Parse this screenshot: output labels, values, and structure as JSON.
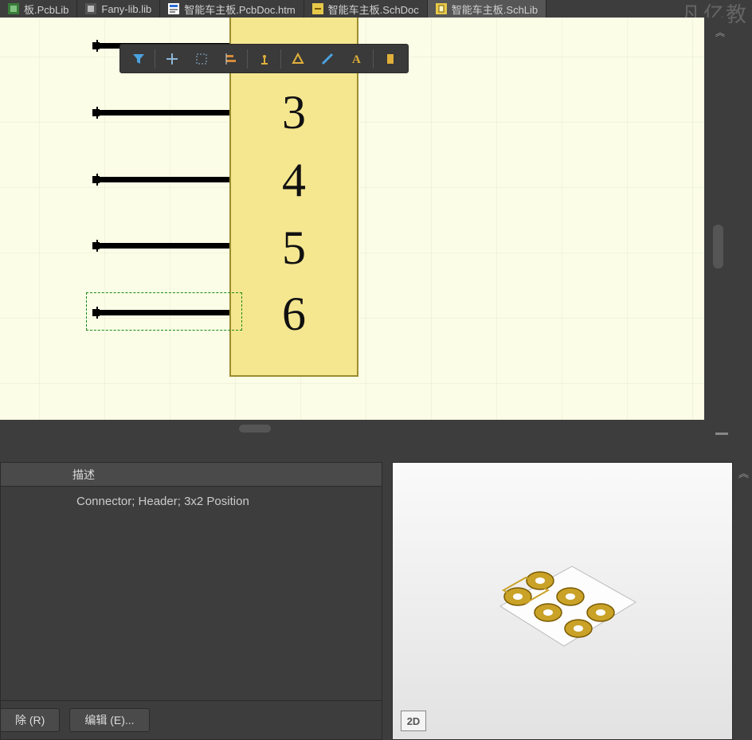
{
  "tabs": [
    {
      "label": "板.PcbLib",
      "icon": "pcblib"
    },
    {
      "label": "Fany-lib.lib",
      "icon": "lib"
    },
    {
      "label": "智能车主板.PcbDoc.htm",
      "icon": "htm"
    },
    {
      "label": "智能车主板.SchDoc",
      "icon": "schdoc"
    },
    {
      "label": "智能车主板.SchLib",
      "icon": "schlib",
      "active": true
    }
  ],
  "watermark": "凡亿教",
  "toolbar": {
    "items": [
      "filter",
      "move",
      "select-rect",
      "align",
      "snap",
      "shape",
      "line",
      "text",
      "component"
    ]
  },
  "component": {
    "pin_numbers": [
      "3",
      "4",
      "5",
      "6"
    ],
    "selected_pin_index": 3
  },
  "info": {
    "header": "描述",
    "description": "Connector; Header; 3x2 Position"
  },
  "buttons": {
    "delete": "除 (R)",
    "edit": "编辑 (E)..."
  },
  "preview": {
    "mode_label": "2D"
  }
}
